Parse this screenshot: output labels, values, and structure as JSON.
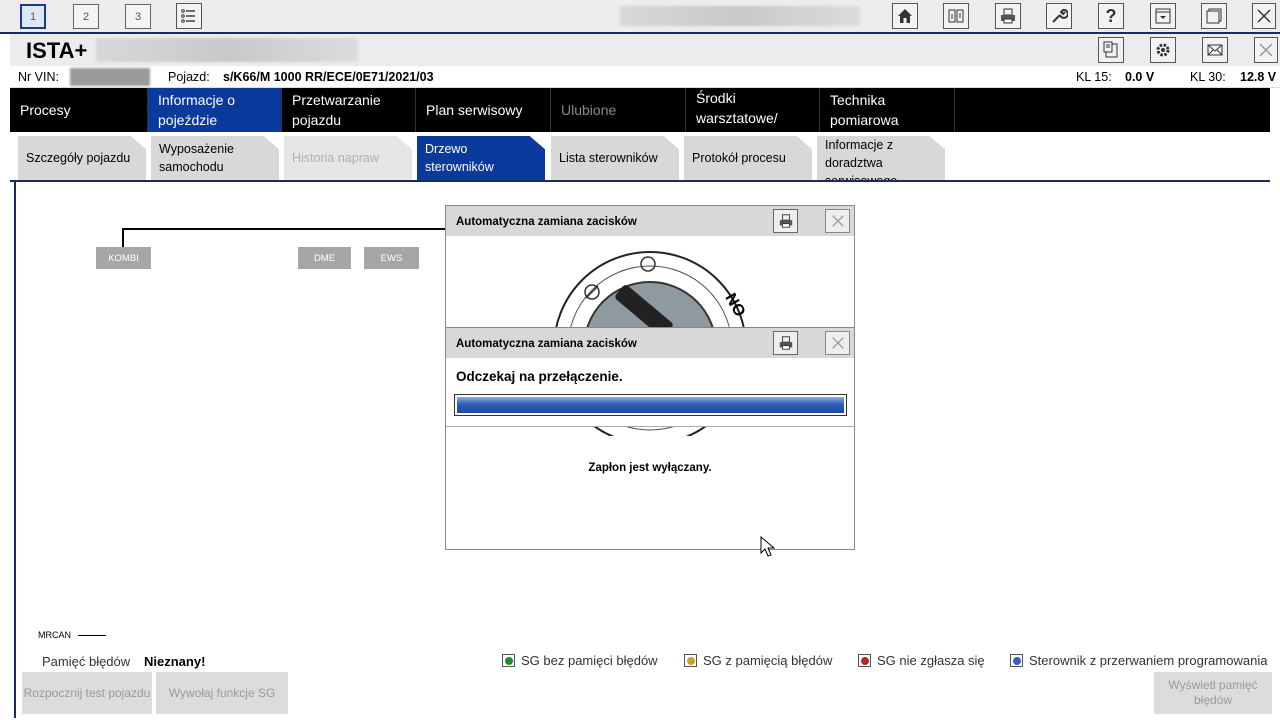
{
  "toolbar": {
    "tabs": [
      "1",
      "2",
      "3"
    ],
    "active_tab": "1",
    "icons": [
      "list-icon",
      "home-icon",
      "compare-icon",
      "print-icon",
      "wrench-icon",
      "help-icon",
      "dropdown-window-icon",
      "window-icon",
      "close-icon"
    ]
  },
  "titlebar": {
    "title": "ISTA+",
    "icons": [
      "clipboard-icon",
      "gear-icon",
      "mail-icon",
      "close-icon"
    ]
  },
  "info": {
    "vin_label": "Nr VIN:",
    "vehicle_label": "Pojazd:",
    "vehicle_value": "s/K66/M 1000 RR/ECE/0E71/2021/03",
    "kl15_label": "KL 15:",
    "kl15_value": "0.0 V",
    "kl30_label": "KL 30:",
    "kl30_value": "12.8 V"
  },
  "mainnav": [
    {
      "label": "Procesy"
    },
    {
      "label": "Informacje o pojeździe"
    },
    {
      "label": "Przetwarzanie pojazdu"
    },
    {
      "label": "Plan serwisowy"
    },
    {
      "label": "Ulubione"
    },
    {
      "label": "Środki warsztatowe/ eksploatacyjne"
    },
    {
      "label": "Technika pomiarowa"
    }
  ],
  "subnav": [
    {
      "label": "Szczegóły pojazdu"
    },
    {
      "label": "Wyposażenie samochodu"
    },
    {
      "label": "Historia napraw"
    },
    {
      "label": "Drzewo sterowników"
    },
    {
      "label": "Lista sterowników"
    },
    {
      "label": "Protokół procesu"
    },
    {
      "label": "Informacje z doradztwa serwisowego"
    }
  ],
  "tree": {
    "ecus": [
      "KOMBI",
      "DME",
      "EWS"
    ],
    "bus_label": "MRCAN"
  },
  "status": {
    "memory_label": "Pamięć błędów",
    "memory_value": "Nieznany!"
  },
  "legend": [
    {
      "label": "SG bez pamięci błędów",
      "color": "#1e8a2e"
    },
    {
      "label": "SG z pamięcią błędów",
      "color": "#c9a227"
    },
    {
      "label": "SG nie zgłasza się",
      "color": "#b02a2a"
    },
    {
      "label": "Sterownik z przerwaniem programowania",
      "color": "#3a5fc8"
    }
  ],
  "buttons": {
    "start_test": "Rozpocznij test pojazdu",
    "call_functions": "Wywołaj funkcje SG",
    "show_memory": "Wyświetl pamięć błędów"
  },
  "dialog_back": {
    "title": "Automatyczna zamiana zacisków"
  },
  "dialog_front": {
    "title": "Automatyczna zamiana zacisków",
    "message": "Odczekaj na przełączenie.",
    "progress": 1.0,
    "status": "Zapłon jest wyłączany."
  }
}
